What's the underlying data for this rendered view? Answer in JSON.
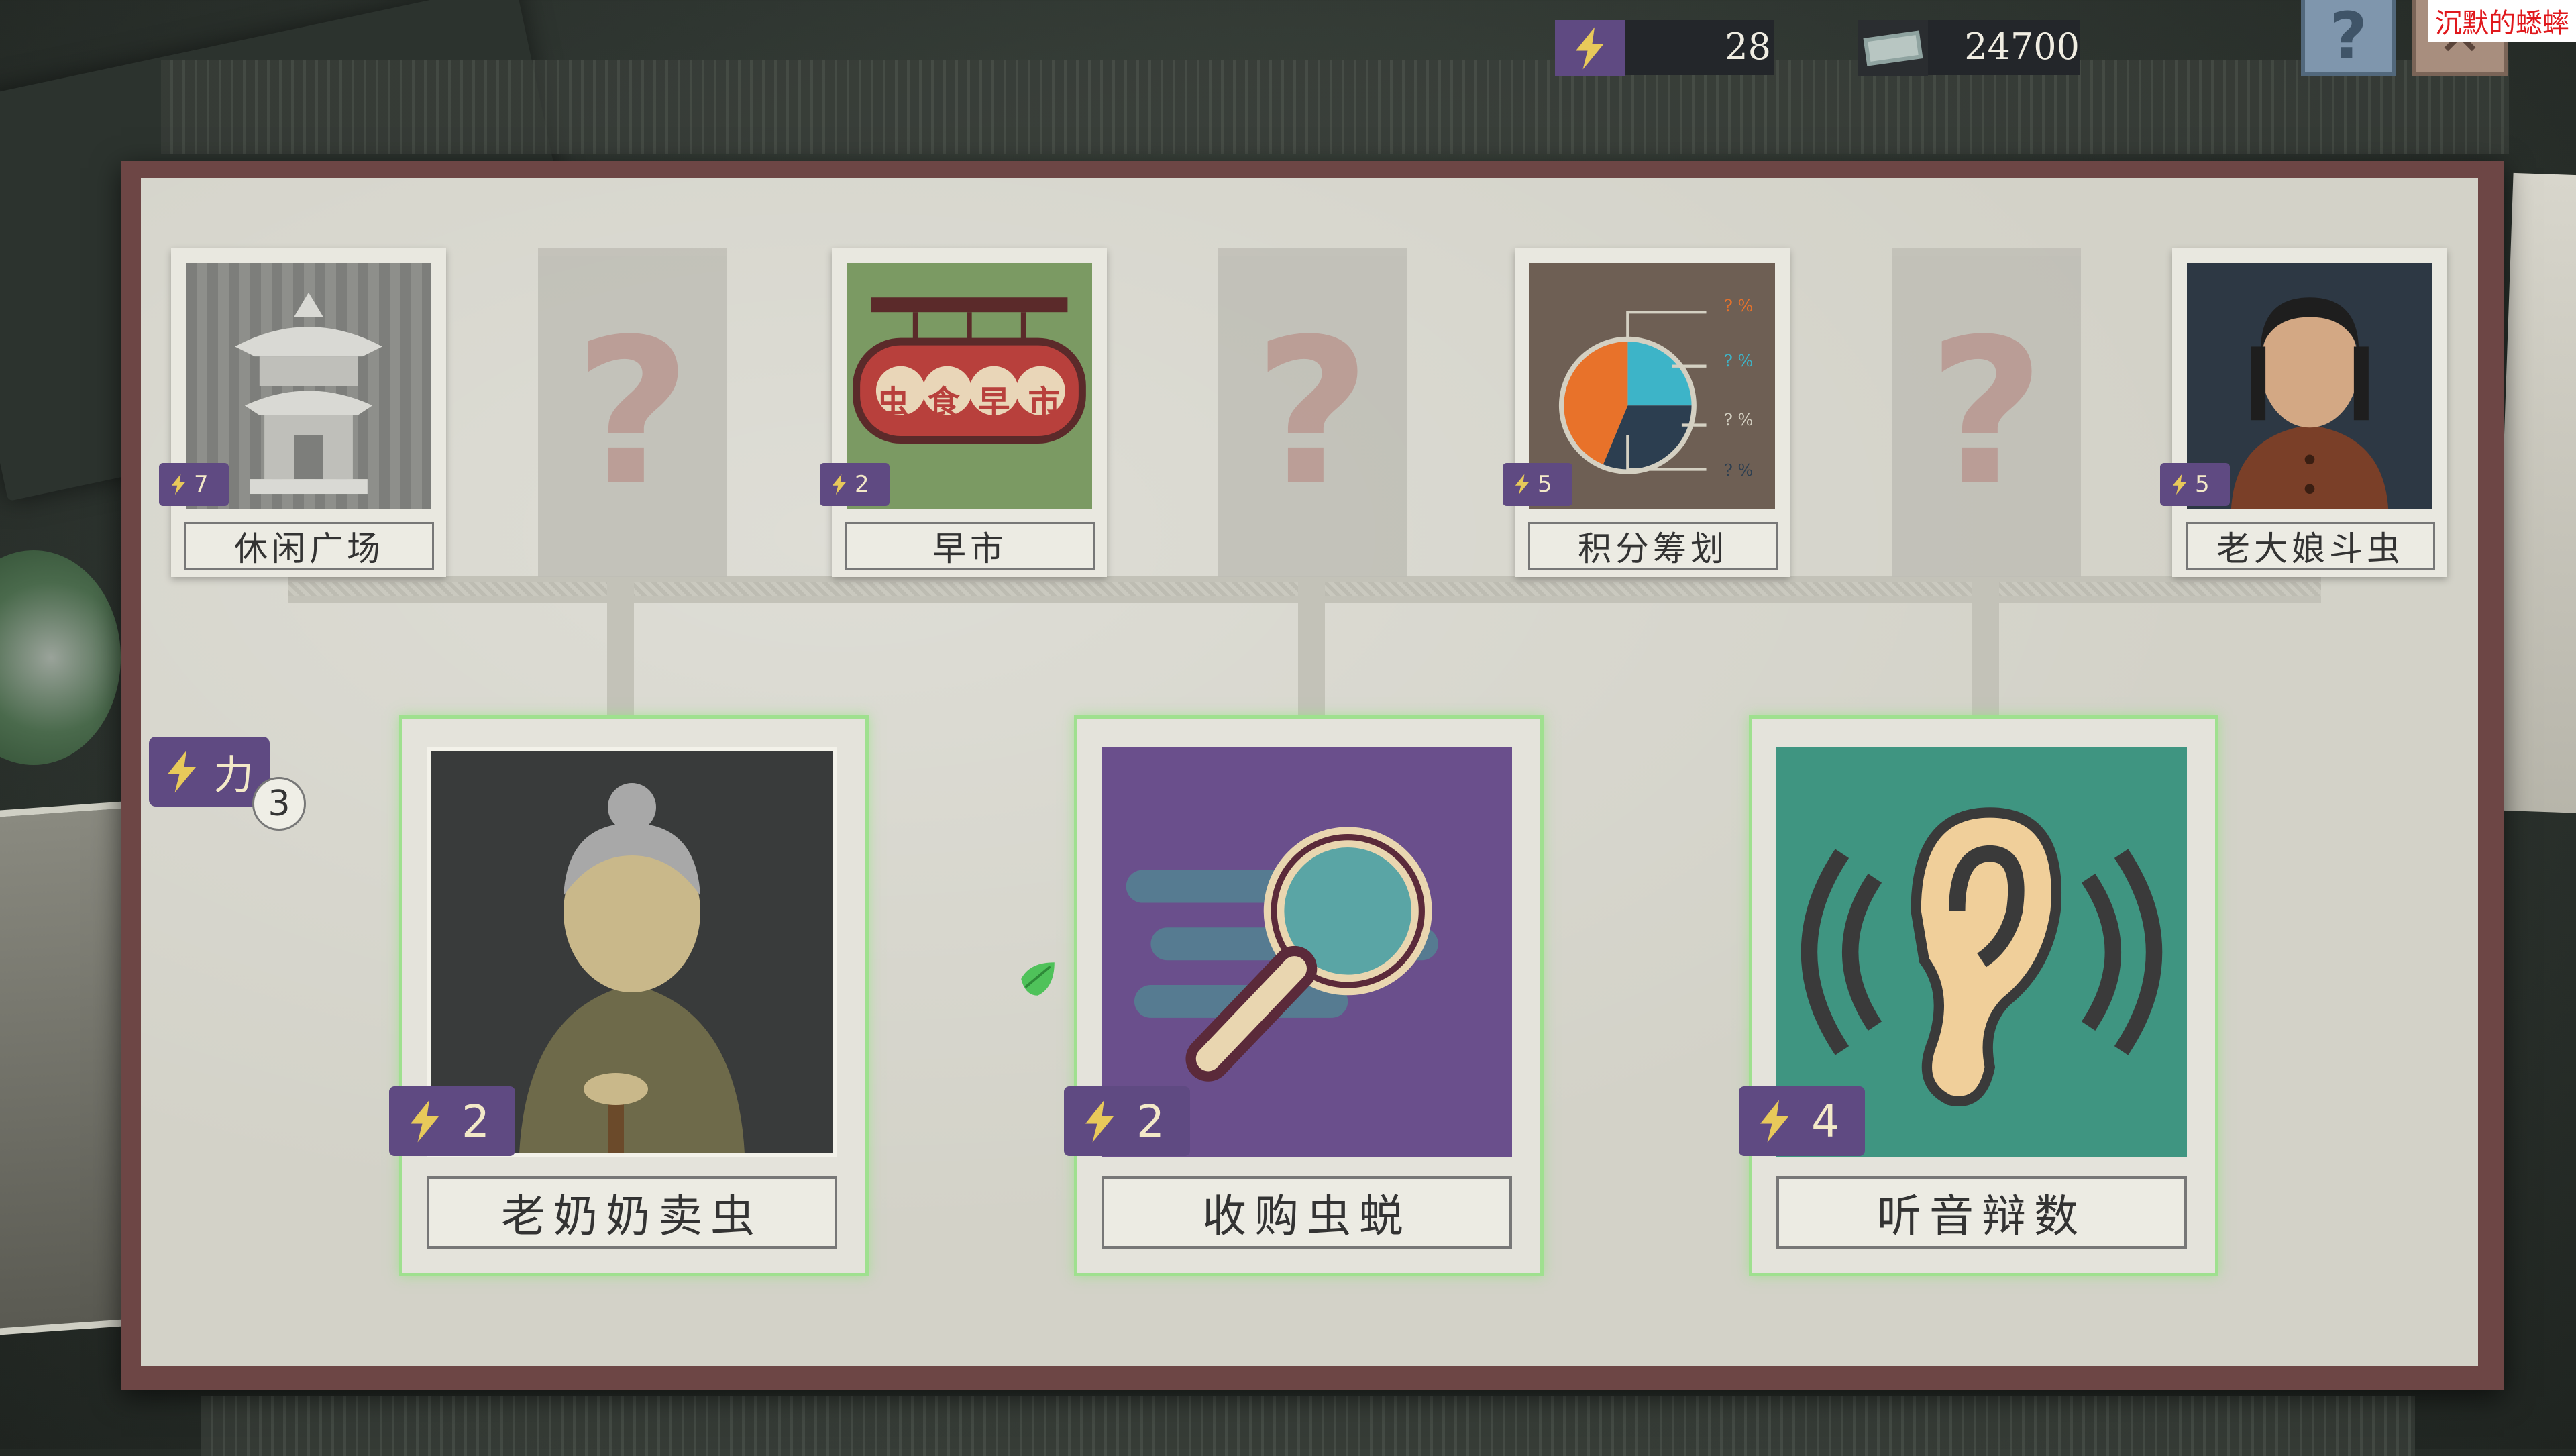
{
  "hud": {
    "energy_icon": "lightning-bolt-icon",
    "energy_value": "28",
    "money_icon": "cash-bill-icon",
    "money_value": "24700",
    "help_label": "?",
    "close_label": "✕"
  },
  "watermark": "沉默的蟋蟀",
  "top_cards": [
    {
      "label": "休闲广场",
      "cost": "7",
      "icon": "pavilion-icon",
      "locked": false
    },
    {
      "label": "",
      "cost": "",
      "icon": "question-mark-icon",
      "locked": true
    },
    {
      "label": "早市",
      "cost": "2",
      "icon": "market-sign-icon",
      "locked": false,
      "sign_text": "虫食早市"
    },
    {
      "label": "",
      "cost": "",
      "icon": "question-mark-icon",
      "locked": true
    },
    {
      "label": "积分筹划",
      "cost": "5",
      "icon": "pie-chart-icon",
      "locked": false,
      "pie_labels": [
        "? %",
        "? %",
        "? %",
        "? %"
      ]
    },
    {
      "label": "",
      "cost": "",
      "icon": "question-mark-icon",
      "locked": true
    },
    {
      "label": "老大娘斗虫",
      "cost": "5",
      "icon": "old-woman-portrait",
      "locked": false
    }
  ],
  "locked_mark": "?",
  "power": {
    "label": "力",
    "count": "3"
  },
  "bottom_cards": [
    {
      "label": "老奶奶卖虫",
      "cost": "2",
      "icon": "old-granny-portrait"
    },
    {
      "label": "收购虫蜕",
      "cost": "2",
      "icon": "magnifier-icon"
    },
    {
      "label": "听音辩数",
      "cost": "4",
      "icon": "ear-icon"
    }
  ],
  "colors": {
    "badge_purple": "#5f4a82",
    "frame": "#6d4645",
    "glow_green": "#9fe08f"
  }
}
